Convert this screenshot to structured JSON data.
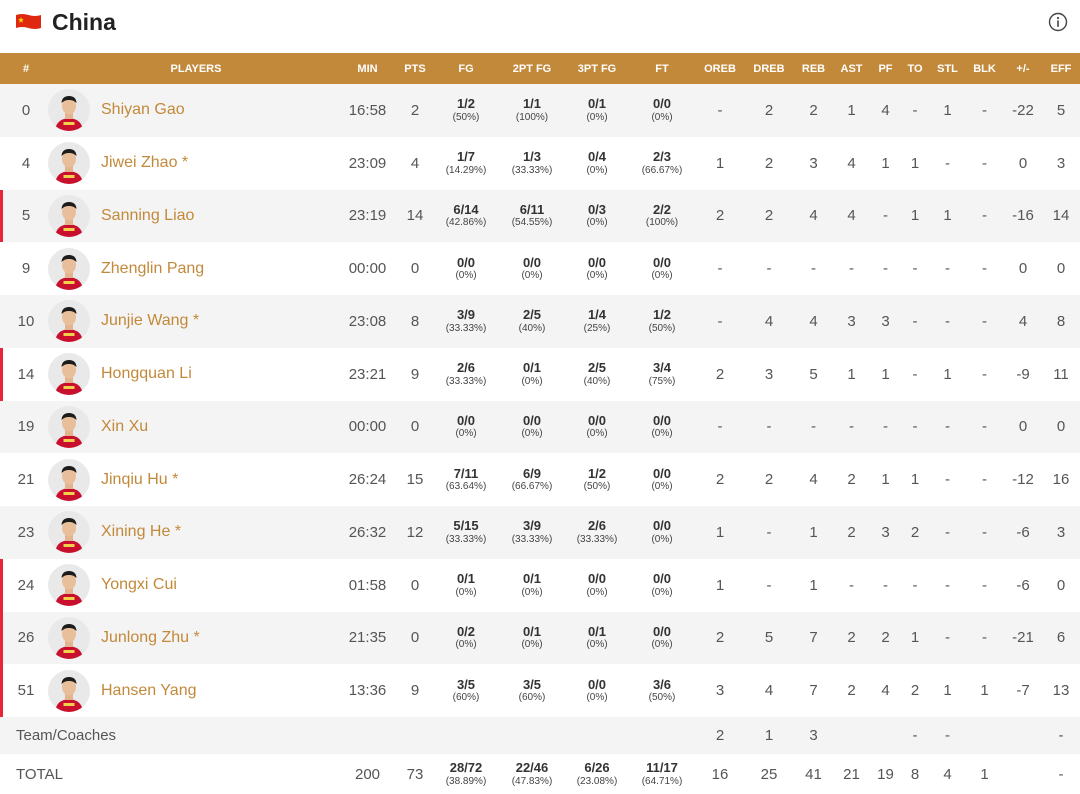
{
  "team": {
    "name": "China",
    "flag_icon": "china-flag-icon",
    "info_icon": "info-icon"
  },
  "colors": {
    "accent": "#c3893a",
    "starter_marker": "#e8243b"
  },
  "columns": [
    "#",
    "PLAYERS",
    "MIN",
    "PTS",
    "FG",
    "2PT FG",
    "3PT FG",
    "FT",
    "OREB",
    "DREB",
    "REB",
    "AST",
    "PF",
    "TO",
    "STL",
    "BLK",
    "+/-",
    "EFF"
  ],
  "players": [
    {
      "num": "0",
      "name": "Shiyan Gao",
      "min": "16:58",
      "pts": "2",
      "fg": "1/2",
      "fg_pct": "(50%)",
      "fg2": "1/1",
      "fg2_pct": "(100%)",
      "fg3": "0/1",
      "fg3_pct": "(0%)",
      "ft": "0/0",
      "ft_pct": "(0%)",
      "oreb": "-",
      "dreb": "2",
      "reb": "2",
      "ast": "1",
      "pf": "4",
      "to": "-",
      "stl": "1",
      "blk": "-",
      "pm": "-22",
      "eff": "5",
      "marked": false
    },
    {
      "num": "4",
      "name": "Jiwei Zhao *",
      "min": "23:09",
      "pts": "4",
      "fg": "1/7",
      "fg_pct": "(14.29%)",
      "fg2": "1/3",
      "fg2_pct": "(33.33%)",
      "fg3": "0/4",
      "fg3_pct": "(0%)",
      "ft": "2/3",
      "ft_pct": "(66.67%)",
      "oreb": "1",
      "dreb": "2",
      "reb": "3",
      "ast": "4",
      "pf": "1",
      "to": "1",
      "stl": "-",
      "blk": "-",
      "pm": "0",
      "eff": "3",
      "marked": false
    },
    {
      "num": "5",
      "name": "Sanning Liao",
      "min": "23:19",
      "pts": "14",
      "fg": "6/14",
      "fg_pct": "(42.86%)",
      "fg2": "6/11",
      "fg2_pct": "(54.55%)",
      "fg3": "0/3",
      "fg3_pct": "(0%)",
      "ft": "2/2",
      "ft_pct": "(100%)",
      "oreb": "2",
      "dreb": "2",
      "reb": "4",
      "ast": "4",
      "pf": "-",
      "to": "1",
      "stl": "1",
      "blk": "-",
      "pm": "-16",
      "eff": "14",
      "marked": true
    },
    {
      "num": "9",
      "name": "Zhenglin Pang",
      "min": "00:00",
      "pts": "0",
      "fg": "0/0",
      "fg_pct": "(0%)",
      "fg2": "0/0",
      "fg2_pct": "(0%)",
      "fg3": "0/0",
      "fg3_pct": "(0%)",
      "ft": "0/0",
      "ft_pct": "(0%)",
      "oreb": "-",
      "dreb": "-",
      "reb": "-",
      "ast": "-",
      "pf": "-",
      "to": "-",
      "stl": "-",
      "blk": "-",
      "pm": "0",
      "eff": "0",
      "marked": false
    },
    {
      "num": "10",
      "name": "Junjie Wang *",
      "min": "23:08",
      "pts": "8",
      "fg": "3/9",
      "fg_pct": "(33.33%)",
      "fg2": "2/5",
      "fg2_pct": "(40%)",
      "fg3": "1/4",
      "fg3_pct": "(25%)",
      "ft": "1/2",
      "ft_pct": "(50%)",
      "oreb": "-",
      "dreb": "4",
      "reb": "4",
      "ast": "3",
      "pf": "3",
      "to": "-",
      "stl": "-",
      "blk": "-",
      "pm": "4",
      "eff": "8",
      "marked": false
    },
    {
      "num": "14",
      "name": "Hongquan Li",
      "min": "23:21",
      "pts": "9",
      "fg": "2/6",
      "fg_pct": "(33.33%)",
      "fg2": "0/1",
      "fg2_pct": "(0%)",
      "fg3": "2/5",
      "fg3_pct": "(40%)",
      "ft": "3/4",
      "ft_pct": "(75%)",
      "oreb": "2",
      "dreb": "3",
      "reb": "5",
      "ast": "1",
      "pf": "1",
      "to": "-",
      "stl": "1",
      "blk": "-",
      "pm": "-9",
      "eff": "11",
      "marked": true
    },
    {
      "num": "19",
      "name": "Xin Xu",
      "min": "00:00",
      "pts": "0",
      "fg": "0/0",
      "fg_pct": "(0%)",
      "fg2": "0/0",
      "fg2_pct": "(0%)",
      "fg3": "0/0",
      "fg3_pct": "(0%)",
      "ft": "0/0",
      "ft_pct": "(0%)",
      "oreb": "-",
      "dreb": "-",
      "reb": "-",
      "ast": "-",
      "pf": "-",
      "to": "-",
      "stl": "-",
      "blk": "-",
      "pm": "0",
      "eff": "0",
      "marked": false
    },
    {
      "num": "21",
      "name": "Jinqiu Hu *",
      "min": "26:24",
      "pts": "15",
      "fg": "7/11",
      "fg_pct": "(63.64%)",
      "fg2": "6/9",
      "fg2_pct": "(66.67%)",
      "fg3": "1/2",
      "fg3_pct": "(50%)",
      "ft": "0/0",
      "ft_pct": "(0%)",
      "oreb": "2",
      "dreb": "2",
      "reb": "4",
      "ast": "2",
      "pf": "1",
      "to": "1",
      "stl": "-",
      "blk": "-",
      "pm": "-12",
      "eff": "16",
      "marked": false
    },
    {
      "num": "23",
      "name": "Xining He *",
      "min": "26:32",
      "pts": "12",
      "fg": "5/15",
      "fg_pct": "(33.33%)",
      "fg2": "3/9",
      "fg2_pct": "(33.33%)",
      "fg3": "2/6",
      "fg3_pct": "(33.33%)",
      "ft": "0/0",
      "ft_pct": "(0%)",
      "oreb": "1",
      "dreb": "-",
      "reb": "1",
      "ast": "2",
      "pf": "3",
      "to": "2",
      "stl": "-",
      "blk": "-",
      "pm": "-6",
      "eff": "3",
      "marked": false
    },
    {
      "num": "24",
      "name": "Yongxi Cui",
      "min": "01:58",
      "pts": "0",
      "fg": "0/1",
      "fg_pct": "(0%)",
      "fg2": "0/1",
      "fg2_pct": "(0%)",
      "fg3": "0/0",
      "fg3_pct": "(0%)",
      "ft": "0/0",
      "ft_pct": "(0%)",
      "oreb": "1",
      "dreb": "-",
      "reb": "1",
      "ast": "-",
      "pf": "-",
      "to": "-",
      "stl": "-",
      "blk": "-",
      "pm": "-6",
      "eff": "0",
      "marked": true
    },
    {
      "num": "26",
      "name": "Junlong Zhu *",
      "min": "21:35",
      "pts": "0",
      "fg": "0/2",
      "fg_pct": "(0%)",
      "fg2": "0/1",
      "fg2_pct": "(0%)",
      "fg3": "0/1",
      "fg3_pct": "(0%)",
      "ft": "0/0",
      "ft_pct": "(0%)",
      "oreb": "2",
      "dreb": "5",
      "reb": "7",
      "ast": "2",
      "pf": "2",
      "to": "1",
      "stl": "-",
      "blk": "-",
      "pm": "-21",
      "eff": "6",
      "marked": true
    },
    {
      "num": "51",
      "name": "Hansen Yang",
      "min": "13:36",
      "pts": "9",
      "fg": "3/5",
      "fg_pct": "(60%)",
      "fg2": "3/5",
      "fg2_pct": "(60%)",
      "fg3": "0/0",
      "fg3_pct": "(0%)",
      "ft": "3/6",
      "ft_pct": "(50%)",
      "oreb": "3",
      "dreb": "4",
      "reb": "7",
      "ast": "2",
      "pf": "4",
      "to": "2",
      "stl": "1",
      "blk": "1",
      "pm": "-7",
      "eff": "13",
      "marked": true
    }
  ],
  "team_row": {
    "label": "Team/Coaches",
    "oreb": "2",
    "dreb": "1",
    "reb": "3",
    "to": "-",
    "stl": "-",
    "eff": "-"
  },
  "total_row": {
    "label": "TOTAL",
    "min": "200",
    "pts": "73",
    "fg": "28/72",
    "fg_pct": "(38.89%)",
    "fg2": "22/46",
    "fg2_pct": "(47.83%)",
    "fg3": "6/26",
    "fg3_pct": "(23.08%)",
    "ft": "11/17",
    "ft_pct": "(64.71%)",
    "oreb": "16",
    "dreb": "25",
    "reb": "41",
    "ast": "21",
    "pf": "19",
    "to": "8",
    "stl": "4",
    "blk": "1",
    "eff": "-"
  }
}
